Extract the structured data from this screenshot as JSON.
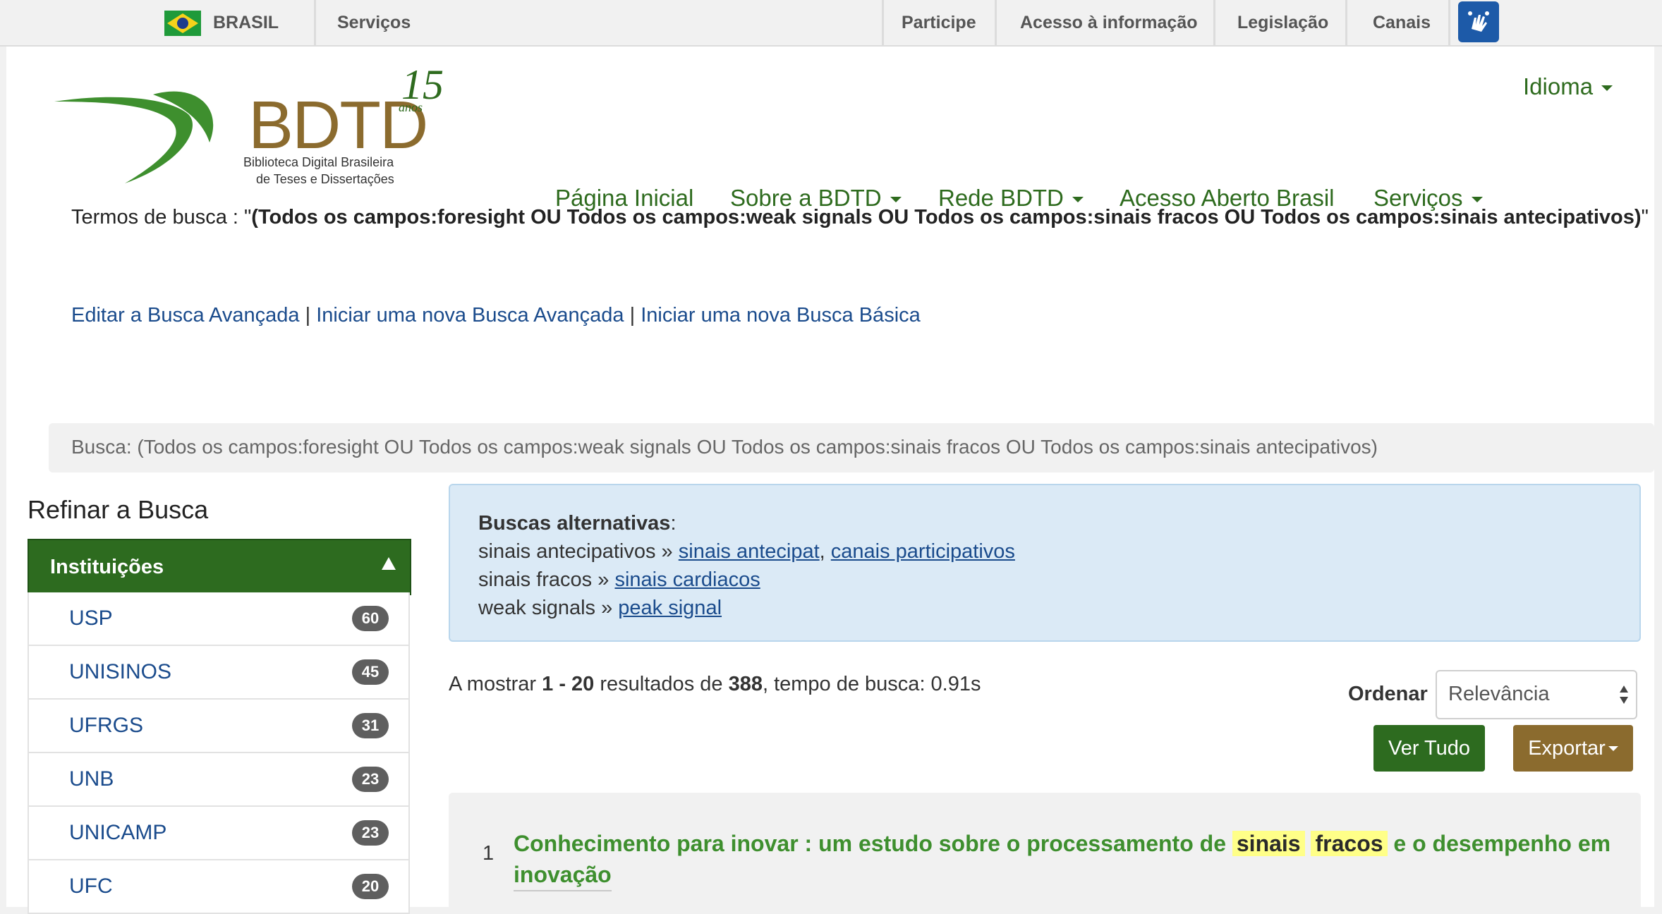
{
  "gov_bar": {
    "country": "BRASIL",
    "services": "Serviços",
    "links": [
      "Participe",
      "Acesso à informação",
      "Legislação",
      "Canais"
    ],
    "accessibility_icon": "sign-language-hands-icon"
  },
  "logo": {
    "name": "BDTD",
    "anniversary_number": "15",
    "anniversary_word": "anos",
    "subtitle_line1": "Biblioteca Digital Brasileira",
    "subtitle_line2": "de Teses e Dissertações"
  },
  "language_menu": "Idioma",
  "nav": {
    "home": "Página Inicial",
    "about": "Sobre a BDTD",
    "network": "Rede BDTD",
    "open_access": "Acesso Aberto Brasil",
    "services": "Serviços"
  },
  "search_terms": {
    "label": "Termos de busca : \"",
    "query": "(Todos os campos:foresight OU Todos os campos:weak signals OU Todos os campos:sinais fracos OU Todos os campos:sinais antecipativos)",
    "close_quote": "\""
  },
  "search_links": {
    "edit_advanced": "Editar a Busca Avançada",
    "separator": "|",
    "new_advanced": "Iniciar uma nova Busca Avançada",
    "new_basic": "Iniciar uma nova Busca Básica"
  },
  "breadcrumb": "Busca: (Todos os campos:foresight OU Todos os campos:weak signals OU Todos os campos:sinais fracos OU Todos os campos:sinais antecipativos)",
  "sidebar": {
    "title": "Refinar a Busca",
    "facet_header": "Instituições",
    "items": [
      {
        "label": "USP",
        "count": "60"
      },
      {
        "label": "UNISINOS",
        "count": "45"
      },
      {
        "label": "UFRGS",
        "count": "31"
      },
      {
        "label": "UNB",
        "count": "23"
      },
      {
        "label": "UNICAMP",
        "count": "23"
      },
      {
        "label": "UFC",
        "count": "20"
      }
    ]
  },
  "alternatives": {
    "title": "Buscas alternativas",
    "colon": ":",
    "rows": [
      {
        "term": "sinais antecipativos",
        "arrow": "»",
        "links": [
          "sinais antecipat",
          "canais participativos"
        ]
      },
      {
        "term": "sinais fracos",
        "arrow": "»",
        "links": [
          "sinais cardiacos"
        ]
      },
      {
        "term": "weak signals",
        "arrow": "»",
        "links": [
          "peak signal"
        ]
      }
    ]
  },
  "results_info": {
    "prefix": "A mostrar",
    "range": "1 - 20",
    "middle": "resultados de",
    "total": "388",
    "suffix": ", tempo de busca: 0.91s"
  },
  "sort": {
    "label": "Ordenar",
    "selected": "Relevância"
  },
  "buttons": {
    "view_all": "Ver Tudo",
    "export": "Exportar"
  },
  "results": [
    {
      "number": "1",
      "title_pre": "Conhecimento para inovar : um estudo sobre o processamento de",
      "highlight1": "sinais",
      "highlight2": "fracos",
      "title_post": "e o desempenho em",
      "title_line2": "inovação"
    }
  ],
  "colors": {
    "brand_green": "#2e6b1e",
    "link_blue": "#1a4b8c",
    "facet_header_bg": "#2d6b1f",
    "export_brown": "#8b6b2e",
    "alt_box_bg": "#dbeaf6",
    "badge_gray": "#5f5f5f"
  }
}
